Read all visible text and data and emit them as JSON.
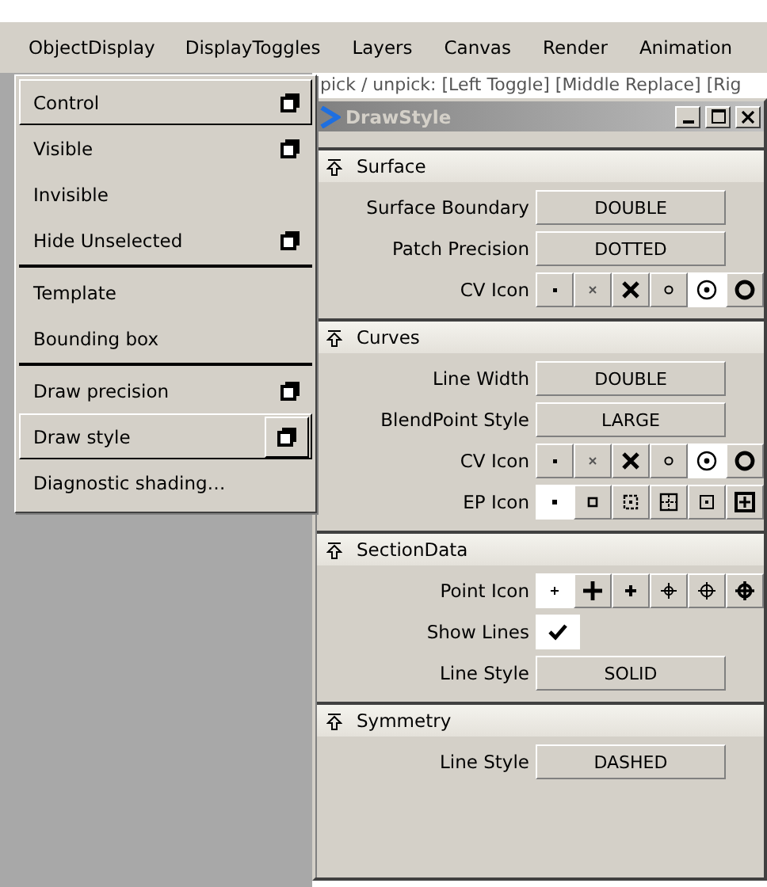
{
  "menu_bar": [
    {
      "label": "ObjectDisplay",
      "selected": true
    },
    {
      "label": "DisplayToggles",
      "selected": false
    },
    {
      "label": "Layers",
      "selected": false
    },
    {
      "label": "Canvas",
      "selected": false
    },
    {
      "label": "Render",
      "selected": false
    },
    {
      "label": "Animation",
      "selected": false
    }
  ],
  "dropdown": {
    "groups": [
      [
        {
          "label": "Control",
          "option_box": true,
          "highlighted": true
        },
        {
          "label": "Visible",
          "option_box": true,
          "highlighted": false
        },
        {
          "label": "Invisible",
          "option_box": false,
          "highlighted": false
        },
        {
          "label": "Hide Unselected",
          "option_box": true,
          "highlighted": false
        }
      ],
      [
        {
          "label": "Template",
          "option_box": false,
          "highlighted": false
        },
        {
          "label": "Bounding box",
          "option_box": false,
          "highlighted": false
        }
      ],
      [
        {
          "label": "Draw precision",
          "option_box": true,
          "highlighted": false
        },
        {
          "label": "Draw style",
          "option_box": true,
          "highlighted": true
        },
        {
          "label": "Diagnostic shading…",
          "option_box": false,
          "highlighted": false
        }
      ]
    ]
  },
  "status_line": "pick / unpick: [Left Toggle] [Middle Replace] [Rig",
  "window": {
    "title": "DrawStyle",
    "sections": [
      {
        "title": "Surface",
        "rows": [
          {
            "kind": "value",
            "label": "Surface Boundary",
            "value": "DOUBLE"
          },
          {
            "kind": "value",
            "label": "Patch Precision",
            "value": "DOTTED"
          },
          {
            "kind": "cv_icons",
            "label": "CV Icon",
            "options": [
              {
                "selected": false
              },
              {
                "selected": false
              },
              {
                "selected": false
              },
              {
                "selected": false
              },
              {
                "selected": true
              },
              {
                "selected": false
              }
            ]
          }
        ]
      },
      {
        "title": "Curves",
        "rows": [
          {
            "kind": "value",
            "label": "Line Width",
            "value": "DOUBLE"
          },
          {
            "kind": "value",
            "label": "BlendPoint Style",
            "value": "LARGE"
          },
          {
            "kind": "cv_icons",
            "label": "CV Icon",
            "options": [
              {
                "selected": false
              },
              {
                "selected": false
              },
              {
                "selected": false
              },
              {
                "selected": false
              },
              {
                "selected": true
              },
              {
                "selected": false
              }
            ]
          },
          {
            "kind": "ep_icons",
            "label": "EP Icon",
            "options": [
              {
                "selected": true
              },
              {
                "selected": false
              },
              {
                "selected": false
              },
              {
                "selected": false
              },
              {
                "selected": false
              },
              {
                "selected": false
              }
            ]
          }
        ]
      },
      {
        "title": "SectionData",
        "rows": [
          {
            "kind": "point_icons",
            "label": "Point Icon",
            "options": [
              {
                "selected": true
              },
              {
                "selected": false
              },
              {
                "selected": false
              },
              {
                "selected": false
              },
              {
                "selected": false
              },
              {
                "selected": false
              }
            ]
          },
          {
            "kind": "checkbox",
            "label": "Show Lines",
            "checked": true
          },
          {
            "kind": "value",
            "label": "Line Style",
            "value": "SOLID"
          }
        ]
      },
      {
        "title": "Symmetry",
        "rows": [
          {
            "kind": "value",
            "label": "Line Style",
            "value": "DASHED"
          }
        ]
      }
    ]
  }
}
